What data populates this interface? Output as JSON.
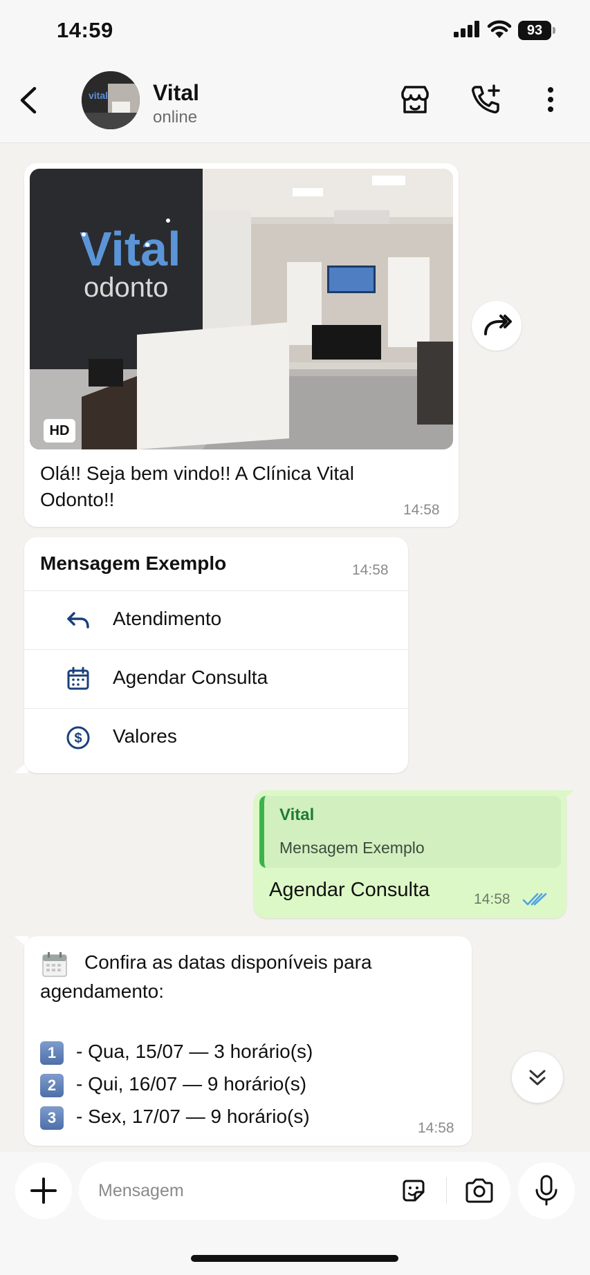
{
  "status_bar": {
    "time": "14:59",
    "battery": "93"
  },
  "header": {
    "contact_name": "Vital",
    "contact_status": "online"
  },
  "messages": {
    "image_message": {
      "badge": "HD",
      "caption": "Olá!! Seja bem vindo!! A Clínica Vital Odonto!!",
      "time": "14:58"
    },
    "menu_message": {
      "title": "Mensagem Exemplo",
      "time": "14:58",
      "items": [
        {
          "label": "Atendimento",
          "icon": "reply-icon"
        },
        {
          "label": "Agendar Consulta",
          "icon": "calendar-icon"
        },
        {
          "label": "Valores",
          "icon": "dollar-icon"
        }
      ]
    },
    "outgoing_message": {
      "quote_name": "Vital",
      "quote_text": "Mensagem Exemplo",
      "text": "Agendar Consulta",
      "time": "14:58"
    },
    "dates_message": {
      "intro_line1": "Confira as datas disponíveis para",
      "intro_line2": "agendamento:",
      "options": [
        {
          "key": "1",
          "text": "- Qua, 15/07 — 3 horário(s)"
        },
        {
          "key": "2",
          "text": "- Qui, 16/07 — 9 horário(s)"
        },
        {
          "key": "3",
          "text": "- Sex, 17/07 — 9 horário(s)"
        }
      ],
      "time": "14:58"
    }
  },
  "composer": {
    "placeholder": "Mensagem"
  },
  "colors": {
    "outgoing_bubble": "#dcf8c6",
    "quote_bar": "#3cb34a",
    "icon_blue": "#1a3f7a",
    "read_ticks": "#4fa3e0"
  }
}
